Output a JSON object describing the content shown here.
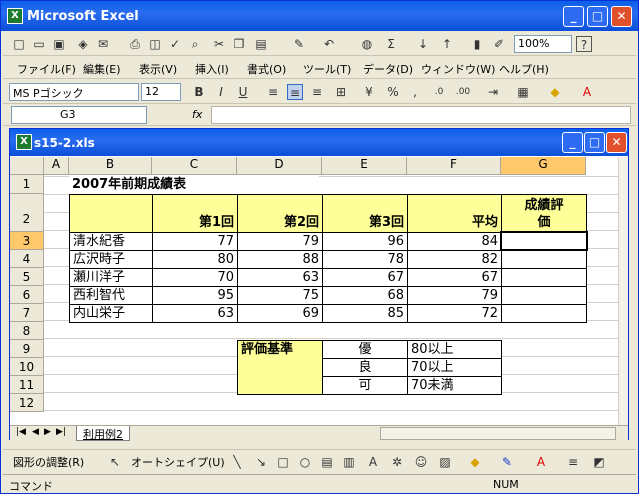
{
  "app": {
    "title": "Microsoft Excel",
    "icon_label": "X",
    "minimize": "_",
    "maximize": "□",
    "close": "✕"
  },
  "toolbar1": {
    "zoom": "100%",
    "help": "?"
  },
  "menu": [
    "ファイル(F)",
    "編集(E)",
    "表示(V)",
    "挿入(I)",
    "書式(O)",
    "ツール(T)",
    "データ(D)",
    "ウィンドウ(W)",
    "ヘルプ(H)"
  ],
  "format": {
    "font": "MS Pゴシック",
    "size": "12",
    "bold": "B",
    "italic": "I",
    "underline": "U",
    "percent": "%",
    "comma": ","
  },
  "formula": {
    "name_box": "G3",
    "fx": "fx",
    "value": ""
  },
  "workbook": {
    "title": "s15-2.xls"
  },
  "columns": [
    "A",
    "B",
    "C",
    "D",
    "E",
    "F",
    "G"
  ],
  "rows": [
    "1",
    "2",
    "3",
    "4",
    "5",
    "6",
    "7",
    "8",
    "9",
    "10",
    "11",
    "12"
  ],
  "sheet": {
    "title": "2007年前期成績表",
    "headers": [
      "第1回",
      "第2回",
      "第3回",
      "平均",
      "成績評価"
    ],
    "students": [
      {
        "name": "清水紀香",
        "r1": "77",
        "r2": "79",
        "r3": "96",
        "avg": "84"
      },
      {
        "name": "広沢時子",
        "r1": "80",
        "r2": "88",
        "r3": "78",
        "avg": "82"
      },
      {
        "name": "瀬川洋子",
        "r1": "70",
        "r2": "63",
        "r3": "67",
        "avg": "67"
      },
      {
        "name": "西利智代",
        "r1": "95",
        "r2": "75",
        "r3": "68",
        "avg": "79"
      },
      {
        "name": "内山栄子",
        "r1": "63",
        "r2": "69",
        "r3": "85",
        "avg": "72"
      }
    ],
    "criteria_label": "評価基準",
    "criteria": [
      {
        "grade": "優",
        "cond": "80以上"
      },
      {
        "grade": "良",
        "cond": "70以上"
      },
      {
        "grade": "可",
        "cond": "70未満"
      }
    ]
  },
  "tab": {
    "name": "利用例2"
  },
  "draw": {
    "adjust": "図形の調整(R)",
    "autoshape": "オートシェイプ(U)"
  },
  "status": {
    "mode": "コマンド",
    "num": "NUM"
  }
}
